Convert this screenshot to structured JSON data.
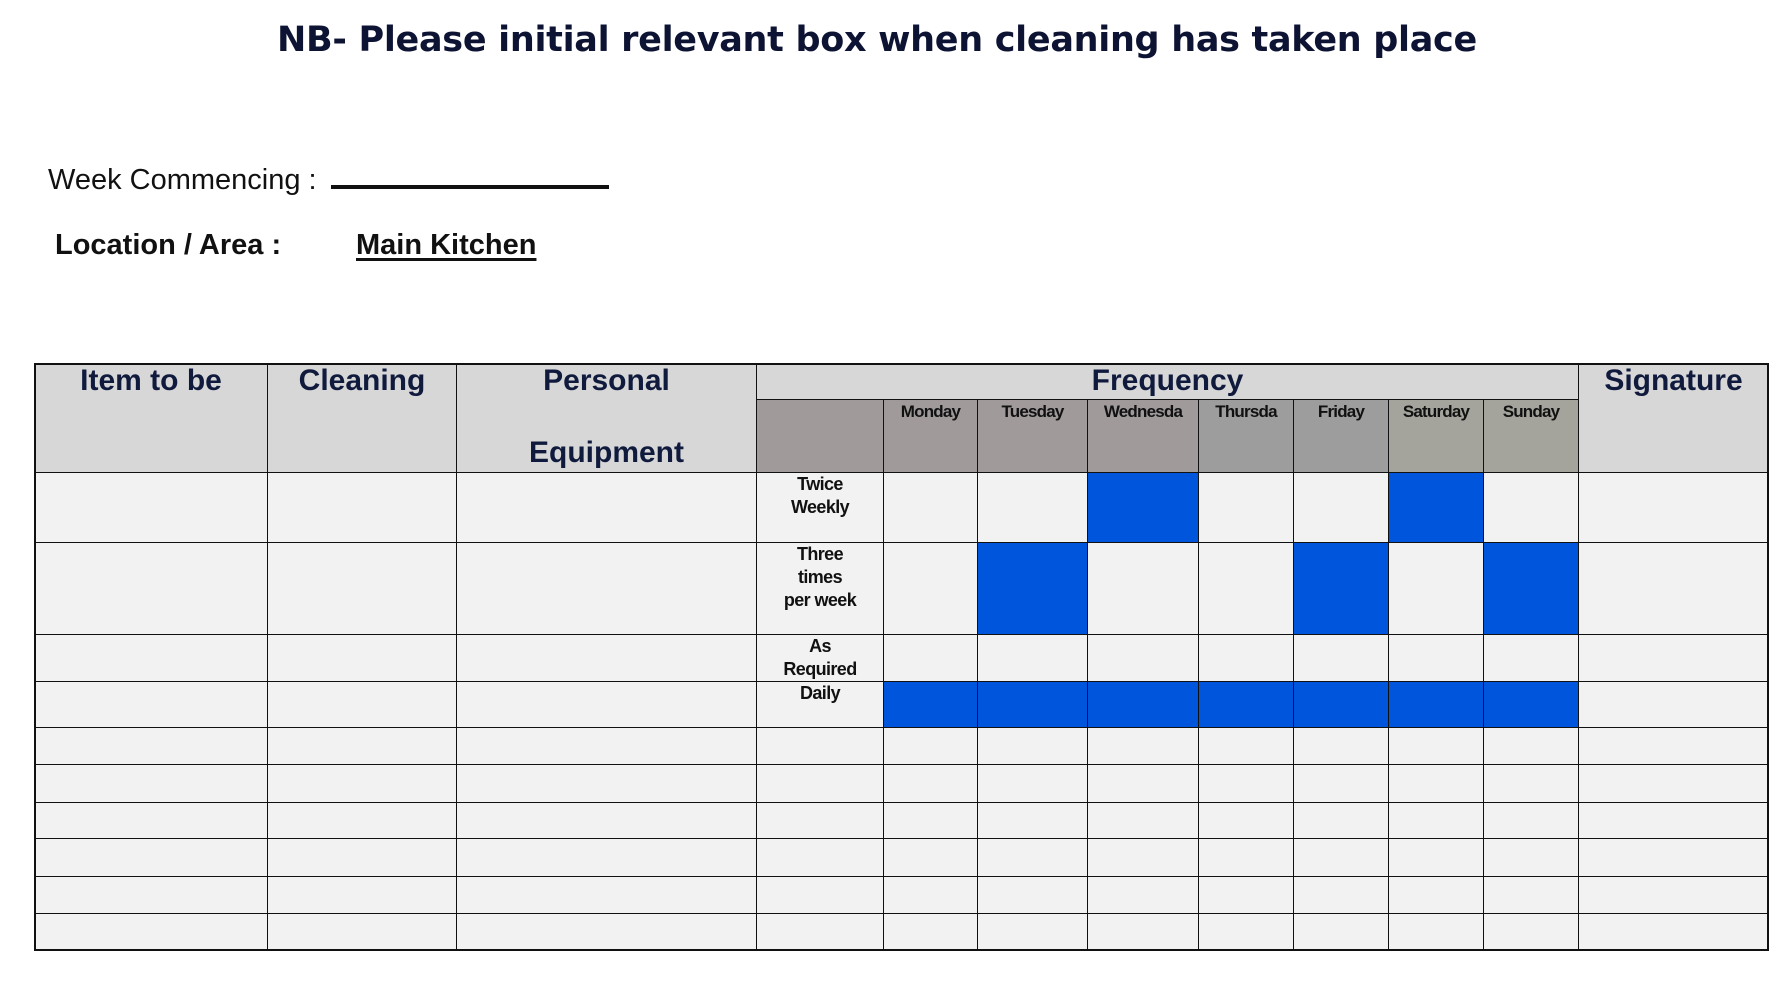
{
  "title": "NB- Please initial relevant box when cleaning has taken place",
  "week_commencing": {
    "label": "Week Commencing :",
    "value": ""
  },
  "location": {
    "label": "Location / Area :",
    "value": "Main Kitchen"
  },
  "table": {
    "headers": {
      "item": "Item to be",
      "cleaning": "Cleaning",
      "personal_line1": "Personal",
      "personal_line2": "Equipment",
      "frequency": "Frequency",
      "signature": "Signature"
    },
    "days": [
      "Monday",
      "Tuesday",
      "Wednesda",
      "Thursda",
      "Friday",
      "Saturday",
      "Sunday"
    ],
    "frequency_rows": [
      {
        "label": "Twice\nWeekly",
        "marked_days": [
          false,
          false,
          true,
          false,
          false,
          true,
          false
        ]
      },
      {
        "label": "Three\ntimes\nper week",
        "marked_days": [
          false,
          true,
          false,
          false,
          true,
          false,
          true
        ]
      },
      {
        "label": "As\nRequired",
        "marked_days": [
          false,
          false,
          false,
          false,
          false,
          false,
          false
        ]
      },
      {
        "label": "Daily",
        "marked_days": [
          true,
          true,
          true,
          true,
          true,
          true,
          true
        ]
      }
    ],
    "blank_rows": 6,
    "colors": {
      "marked": "#0055dd",
      "header": "#d7d7d7",
      "body": "#f2f2f2",
      "header_text": "#0f1a3d"
    }
  }
}
